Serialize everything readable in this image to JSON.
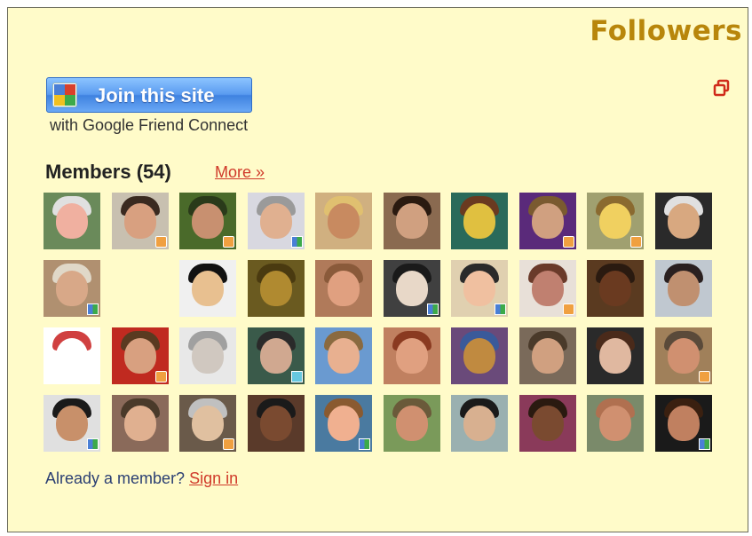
{
  "widget": {
    "title": "Followers",
    "join_button_label": "Join this site",
    "subtitle": "with Google Friend Connect",
    "members_heading": "Members (54)",
    "more_link": "More »",
    "footer_prefix": "Already a member?",
    "sign_in_link": "Sign in"
  },
  "colors": {
    "background": "#fffbc9",
    "title": "#b8860b",
    "link": "#d03a2a",
    "button": "#4a8ff0"
  },
  "members": [
    {
      "bg": "#6a8a5a",
      "skin": "#f0b0a0",
      "hair": "#e0e0e0",
      "badge": "none"
    },
    {
      "bg": "#c8c0b0",
      "skin": "#d8a080",
      "hair": "#3a2a20",
      "badge": "b"
    },
    {
      "bg": "#4a6a2a",
      "skin": "#c89070",
      "hair": "#2a3a1a",
      "badge": "b"
    },
    {
      "bg": "#d8d8e0",
      "skin": "#e0b090",
      "hair": "#9a9a9a",
      "badge": "g"
    },
    {
      "bg": "#d0b080",
      "skin": "#c88a60",
      "hair": "#e0c070",
      "badge": "none"
    },
    {
      "bg": "#8a6a50",
      "skin": "#d0a080",
      "hair": "#2a1a10",
      "badge": "none"
    },
    {
      "bg": "#2a6a5a",
      "skin": "#e0c040",
      "hair": "#6a3a20",
      "badge": "none"
    },
    {
      "bg": "#5a2a7a",
      "skin": "#d0a080",
      "hair": "#7a5a30",
      "badge": "b"
    },
    {
      "bg": "#a0a070",
      "skin": "#f0d060",
      "hair": "#8a6a30",
      "badge": "b"
    },
    {
      "bg": "#2a2a2a",
      "skin": "#d8a880",
      "hair": "#e0e0e0",
      "badge": "none"
    },
    {
      "bg": "#b09070",
      "skin": "#d8a888",
      "hair": "#e0d8c8",
      "badge": "g"
    },
    {
      "bg": "#fffbc9",
      "skin": "#fffbc9",
      "hair": "#fffbc9",
      "badge": "none"
    },
    {
      "bg": "#f0f0f0",
      "skin": "#e8c090",
      "hair": "#111111",
      "badge": "none"
    },
    {
      "bg": "#6a5a20",
      "skin": "#b08a30",
      "hair": "#4a3a10",
      "badge": "none"
    },
    {
      "bg": "#b07a5a",
      "skin": "#e0a080",
      "hair": "#8a5a3a",
      "badge": "none"
    },
    {
      "bg": "#404040",
      "skin": "#e8d8c8",
      "hair": "#1a1a1a",
      "badge": "g"
    },
    {
      "bg": "#e0d0b0",
      "skin": "#f0c0a0",
      "hair": "#2a2a2a",
      "badge": "g"
    },
    {
      "bg": "#e8e0d8",
      "skin": "#c08070",
      "hair": "#6a3a2a",
      "badge": "b"
    },
    {
      "bg": "#5a3a20",
      "skin": "#6a3a20",
      "hair": "#2a1a10",
      "badge": "none"
    },
    {
      "bg": "#c0c8d0",
      "skin": "#c09070",
      "hair": "#2a2020",
      "badge": "none"
    },
    {
      "bg": "#ffffff",
      "skin": "#ffffff",
      "hair": "#d04040",
      "badge": "none"
    },
    {
      "bg": "#c02a20",
      "skin": "#d8a080",
      "hair": "#5a3a20",
      "badge": "b"
    },
    {
      "bg": "#e8e8e8",
      "skin": "#d0c8c0",
      "hair": "#a0a0a0",
      "badge": "none"
    },
    {
      "bg": "#3a5a4a",
      "skin": "#d0a890",
      "hair": "#2a2a2a",
      "badge": "c"
    },
    {
      "bg": "#6a9ad0",
      "skin": "#e8b090",
      "hair": "#8a6a40",
      "badge": "none"
    },
    {
      "bg": "#c08060",
      "skin": "#e0a080",
      "hair": "#8a3a20",
      "badge": "none"
    },
    {
      "bg": "#6a4a7a",
      "skin": "#c08a40",
      "hair": "#3a5a9a",
      "badge": "none"
    },
    {
      "bg": "#7a6a5a",
      "skin": "#d0a080",
      "hair": "#4a3a2a",
      "badge": "none"
    },
    {
      "bg": "#2a2a2a",
      "skin": "#e0b8a0",
      "hair": "#4a2a1a",
      "badge": "none"
    },
    {
      "bg": "#a0805a",
      "skin": "#d09070",
      "hair": "#5a4a3a",
      "badge": "b"
    },
    {
      "bg": "#e0e0e0",
      "skin": "#c8906a",
      "hair": "#1a1a1a",
      "badge": "g"
    },
    {
      "bg": "#8a6a5a",
      "skin": "#e0b090",
      "hair": "#4a3a2a",
      "badge": "none"
    },
    {
      "bg": "#6a5a4a",
      "skin": "#e0c0a0",
      "hair": "#c0c0c0",
      "badge": "b"
    },
    {
      "bg": "#5a3a2a",
      "skin": "#7a4a30",
      "hair": "#1a1a1a",
      "badge": "none"
    },
    {
      "bg": "#4a7aa0",
      "skin": "#f0b090",
      "hair": "#8a5a30",
      "badge": "g"
    },
    {
      "bg": "#7a9a5a",
      "skin": "#d09070",
      "hair": "#6a5a3a",
      "badge": "none"
    },
    {
      "bg": "#9ab0b0",
      "skin": "#d8b090",
      "hair": "#1a1a1a",
      "badge": "none"
    },
    {
      "bg": "#8a3a5a",
      "skin": "#7a4a30",
      "hair": "#2a1a10",
      "badge": "none"
    },
    {
      "bg": "#7a8a6a",
      "skin": "#d09070",
      "hair": "#b07050",
      "badge": "none"
    },
    {
      "bg": "#1a1a1a",
      "skin": "#c08060",
      "hair": "#3a2010",
      "badge": "g"
    }
  ]
}
